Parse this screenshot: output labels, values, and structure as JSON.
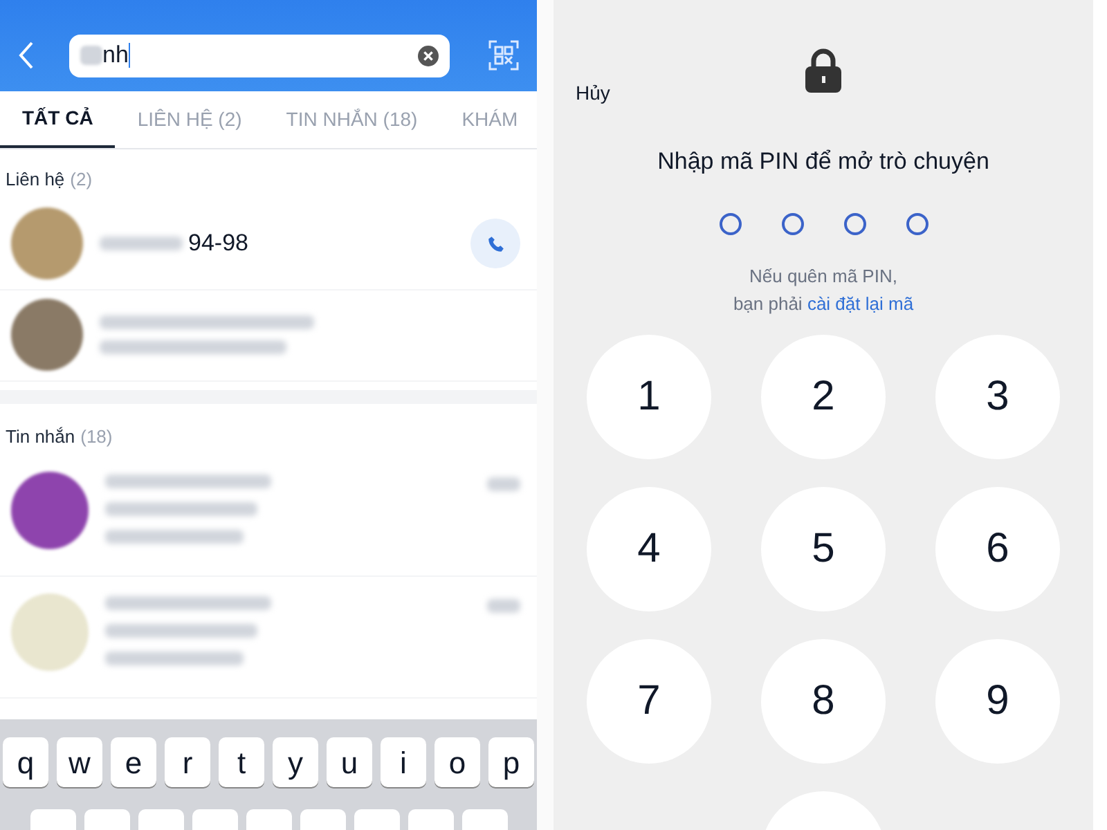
{
  "search": {
    "value": "nh"
  },
  "tabs": [
    {
      "label": "TẤT CẢ",
      "selected": true
    },
    {
      "label": "LIÊN HỆ (2)",
      "selected": false
    },
    {
      "label": "TIN NHẮN (18)",
      "selected": false
    },
    {
      "label": "KHÁM",
      "selected": false
    }
  ],
  "contacts": {
    "title": "Liên hệ",
    "count": "(2)",
    "items": [
      {
        "name": "94-98",
        "call": true,
        "color": "#b59a6e"
      },
      {
        "call": false,
        "color": "#8a7a66"
      }
    ]
  },
  "messages": {
    "title": "Tin nhắn",
    "count": "(18)",
    "items": [
      {
        "color": "#8e44ad"
      },
      {
        "color": "#e9e6cf"
      }
    ]
  },
  "keyboard": {
    "row_1": [
      "q",
      "w",
      "e",
      "r",
      "t",
      "y",
      "u",
      "i",
      "o",
      "p"
    ]
  },
  "pin": {
    "cancel": "Hủy",
    "title": "Nhập mã PIN để mở trò chuyện",
    "digits": [
      {
        "filled": false
      },
      {
        "filled": false
      },
      {
        "filled": false
      },
      {
        "filled": false
      }
    ],
    "hint": "Nếu quên mã PIN,",
    "hint_2": "bạn phải",
    "reset_link": "cài đặt lại mã",
    "keys": [
      "1",
      "2",
      "3",
      "4",
      "5",
      "6",
      "7",
      "8",
      "9"
    ]
  }
}
